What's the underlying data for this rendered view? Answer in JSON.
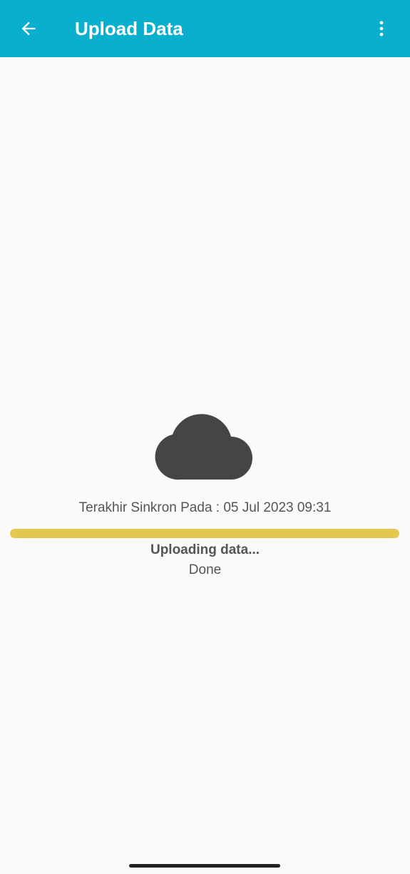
{
  "appbar": {
    "title": "Upload Data",
    "back_icon": "arrow-back-icon",
    "menu_icon": "more-vert-icon",
    "background": "#0aafcd"
  },
  "main": {
    "cloud_icon": "cloud-icon",
    "last_sync_text": "Terakhir Sinkron Pada : 05 Jul 2023 09:31",
    "progress": {
      "value_percent": 100,
      "color": "#e4c74e"
    },
    "status_title": "Uploading data...",
    "status_detail": "Done"
  }
}
